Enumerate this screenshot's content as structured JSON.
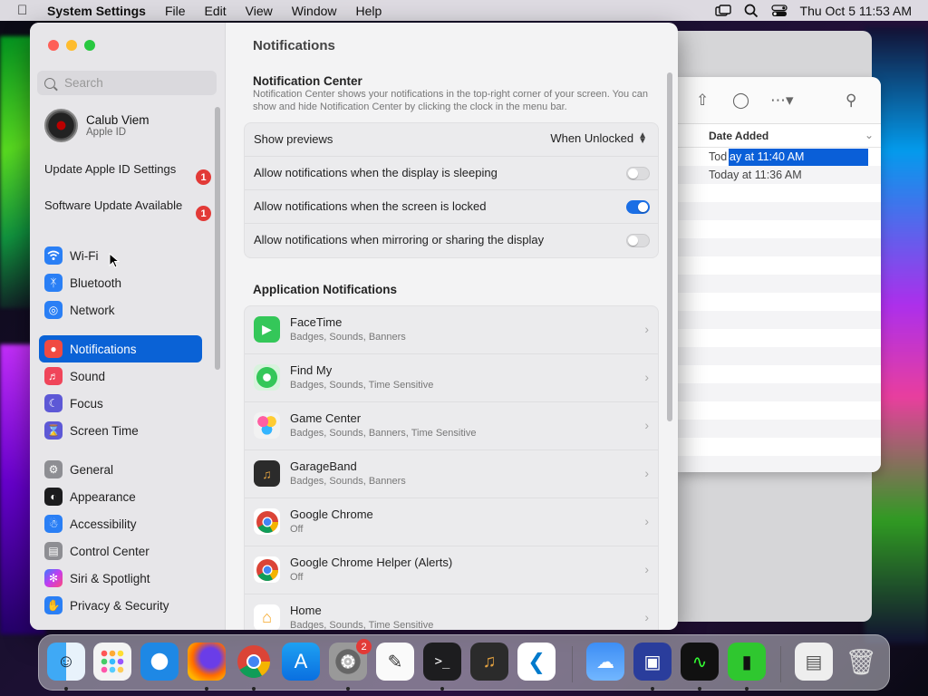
{
  "menubar": {
    "app_name": "System Settings",
    "items": [
      "File",
      "Edit",
      "View",
      "Window",
      "Help"
    ],
    "clock": "Thu Oct 5  11:53 AM"
  },
  "finder": {
    "column_header": "Date Added",
    "rows": [
      "Today at 11:40 AM",
      "Today at 11:36 AM"
    ],
    "selected_prefix": "Tod",
    "selected_suffix": "ay at 11:40 AM"
  },
  "sidebar": {
    "search_placeholder": "Search",
    "account": {
      "name": "Calub Viem",
      "subtitle": "Apple ID"
    },
    "alerts": [
      {
        "label": "Update Apple ID Settings",
        "count": "1"
      },
      {
        "label": "Software Update Available",
        "count": "1"
      }
    ],
    "items": [
      {
        "label": "Wi-Fi",
        "icon": "wifi-icon",
        "color": "#2a7ff5"
      },
      {
        "label": "Bluetooth",
        "icon": "bluetooth-icon",
        "color": "#2a7ff5"
      },
      {
        "label": "Network",
        "icon": "globe-icon",
        "color": "#2a7ff5"
      },
      {
        "label": "Notifications",
        "icon": "bell-icon",
        "color": "#f04a42"
      },
      {
        "label": "Sound",
        "icon": "speaker-icon",
        "color": "#f0455a"
      },
      {
        "label": "Focus",
        "icon": "moon-icon",
        "color": "#5d58d6"
      },
      {
        "label": "Screen Time",
        "icon": "hourglass-icon",
        "color": "#5d58d6"
      },
      {
        "label": "General",
        "icon": "gear-icon",
        "color": "#8e8e93"
      },
      {
        "label": "Appearance",
        "icon": "appearance-icon",
        "color": "#1c1c1e"
      },
      {
        "label": "Accessibility",
        "icon": "accessibility-icon",
        "color": "#2a7ff5"
      },
      {
        "label": "Control Center",
        "icon": "control-center-icon",
        "color": "#8e8e93"
      },
      {
        "label": "Siri & Spotlight",
        "icon": "siri-icon",
        "color": "#b548e0"
      },
      {
        "label": "Privacy & Security",
        "icon": "hand-icon",
        "color": "#2a7ff5"
      }
    ]
  },
  "content": {
    "title": "Notifications",
    "nc_heading": "Notification Center",
    "nc_description": "Notification Center shows your notifications in the top-right corner of your screen. You can show and hide Notification Center by clicking the clock in the menu bar.",
    "show_previews_label": "Show previews",
    "show_previews_value": "When Unlocked",
    "toggles": [
      {
        "label": "Allow notifications when the display is sleeping",
        "on": false
      },
      {
        "label": "Allow notifications when the screen is locked",
        "on": true
      },
      {
        "label": "Allow notifications when mirroring or sharing the display",
        "on": false
      }
    ],
    "app_heading": "Application Notifications",
    "apps": [
      {
        "name": "FaceTime",
        "detail": "Badges, Sounds, Banners",
        "icon": "facetime-icon",
        "color": "#34c759"
      },
      {
        "name": "Find My",
        "detail": "Badges, Sounds, Time Sensitive",
        "icon": "findmy-icon",
        "color": "#34c759"
      },
      {
        "name": "Game Center",
        "detail": "Badges, Sounds, Banners, Time Sensitive",
        "icon": "gamecenter-icon",
        "color": "#f2f2f2"
      },
      {
        "name": "GarageBand",
        "detail": "Badges, Sounds, Banners",
        "icon": "garageband-icon",
        "color": "#2b2b2b"
      },
      {
        "name": "Google Chrome",
        "detail": "Off",
        "icon": "chrome-icon",
        "color": "#ffffff"
      },
      {
        "name": "Google Chrome Helper (Alerts)",
        "detail": "Off",
        "icon": "chrome-icon",
        "color": "#ffffff"
      },
      {
        "name": "Home",
        "detail": "Badges, Sounds, Time Sensitive",
        "icon": "home-icon",
        "color": "#ffffff"
      }
    ]
  },
  "dock": {
    "settings_badge": "2"
  }
}
